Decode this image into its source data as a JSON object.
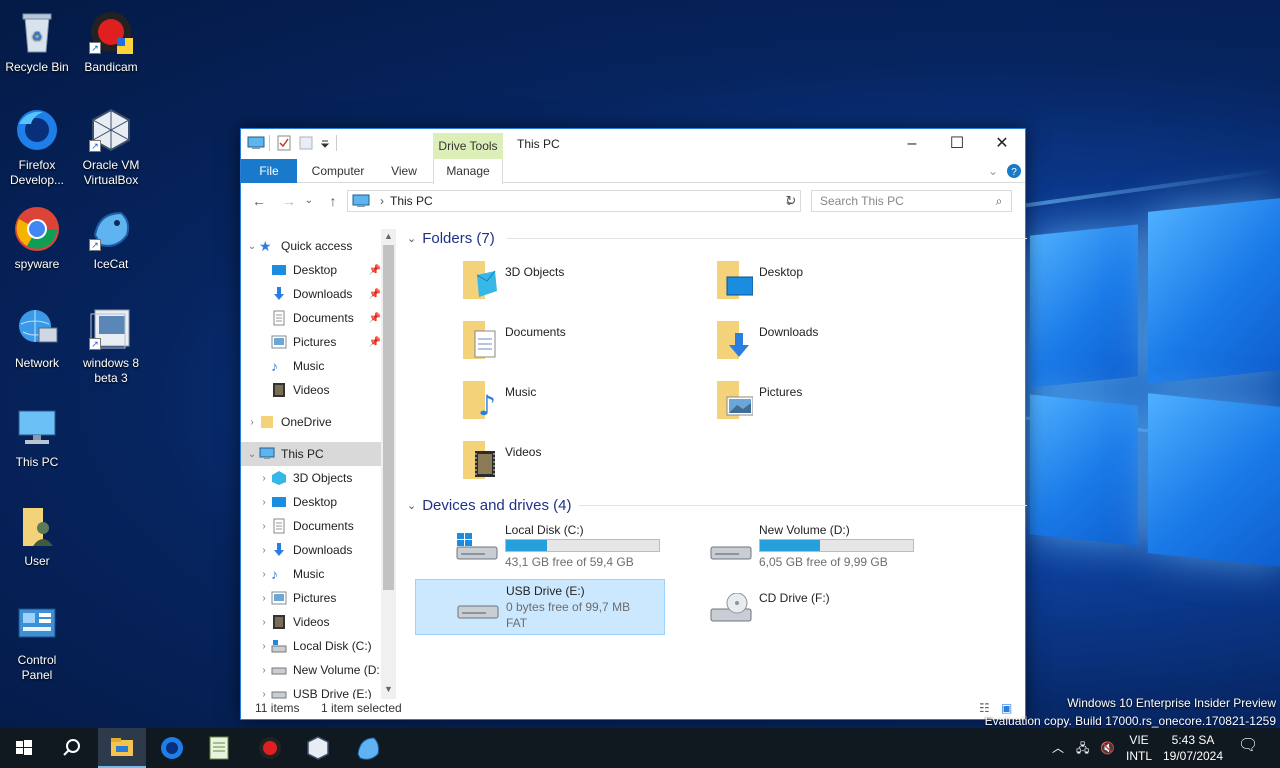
{
  "desktop": {
    "icons": [
      {
        "label": "Recycle Bin"
      },
      {
        "label": "Bandicam"
      },
      {
        "label": "Firefox Develop..."
      },
      {
        "label": "Oracle VM VirtualBox"
      },
      {
        "label": "spyware"
      },
      {
        "label": "IceCat"
      },
      {
        "label": "Network"
      },
      {
        "label": "windows 8 beta 3"
      },
      {
        "label": "This PC"
      },
      {
        "label": "User"
      },
      {
        "label": "Control Panel"
      }
    ],
    "watermark": {
      "line1": "Windows 10 Enterprise Insider Preview",
      "line2": "Evaluation copy. Build 17000.rs_onecore.170821-1259"
    }
  },
  "window": {
    "title": "This PC",
    "context_tab": "Drive Tools",
    "ribbon_tabs": [
      "File",
      "Computer",
      "View",
      "Manage"
    ],
    "address": "This PC",
    "search_placeholder": "Search This PC",
    "nav": {
      "quick_access": "Quick access",
      "quick_items": [
        "Desktop",
        "Downloads",
        "Documents",
        "Pictures",
        "Music",
        "Videos"
      ],
      "onedrive": "OneDrive",
      "this_pc": "This PC",
      "pc_items": [
        "3D Objects",
        "Desktop",
        "Documents",
        "Downloads",
        "Music",
        "Pictures",
        "Videos",
        "Local Disk (C:)",
        "New Volume (D:",
        "USB Drive (E:)"
      ]
    },
    "folders_header": "Folders (7)",
    "folders": [
      "3D Objects",
      "Desktop",
      "Documents",
      "Downloads",
      "Music",
      "Pictures",
      "Videos"
    ],
    "drives_header": "Devices and drives (4)",
    "drives": [
      {
        "name": "Local Disk (C:)",
        "free": "43,1 GB free of 59,4 GB",
        "used_fraction": 0.27
      },
      {
        "name": "New Volume (D:)",
        "free": "6,05 GB free of 9,99 GB",
        "used_fraction": 0.39
      },
      {
        "name": "USB Drive (E:)",
        "free": "0 bytes free of 99,7 MB",
        "fs": "FAT"
      },
      {
        "name": "CD Drive (F:)"
      }
    ],
    "status": {
      "items": "11 items",
      "selected": "1 item selected"
    }
  },
  "taskbar": {
    "lang_top": "VIE",
    "lang_bottom": "INTL",
    "time": "5:43 SA",
    "date": "19/07/2024"
  },
  "colors": {
    "accent": "#1979ca",
    "selection": "#cce8ff",
    "drive_bar": "#26a0da",
    "group_header": "#1e3287"
  }
}
